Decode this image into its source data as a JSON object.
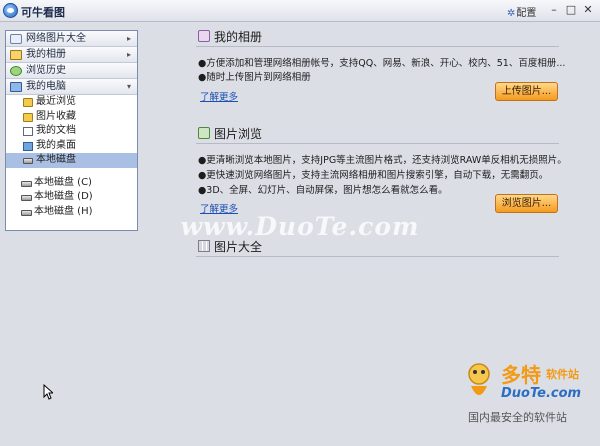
{
  "window": {
    "title": "可牛看图",
    "config_label": "配置",
    "min_glyph": "–",
    "max_glyph": "□",
    "close_glyph": "✕"
  },
  "sidebar": {
    "headers": [
      {
        "label": "网络图片大全",
        "icon": "globe-icon",
        "arrow": "▸"
      },
      {
        "label": "我的相册",
        "icon": "album-icon",
        "arrow": "▸"
      },
      {
        "label": "浏览历史",
        "icon": "history-icon",
        "arrow": ""
      },
      {
        "label": "我的电脑",
        "icon": "computer-icon",
        "arrow": "▾"
      }
    ],
    "items": [
      {
        "label": "最近浏览",
        "icon": "folder-icon"
      },
      {
        "label": "图片收藏",
        "icon": "folder-icon"
      },
      {
        "label": "我的文档",
        "icon": "document-icon"
      },
      {
        "label": "我的桌面",
        "icon": "desktop-icon"
      },
      {
        "label": "本地磁盘",
        "icon": "drive-icon",
        "selected": true
      }
    ],
    "drives": [
      {
        "label": "本地磁盘 (C)",
        "icon": "drive-icon"
      },
      {
        "label": "本地磁盘 (D)",
        "icon": "drive-icon"
      },
      {
        "label": "本地磁盘 (H)",
        "icon": "drive-icon"
      }
    ]
  },
  "sections": {
    "album": {
      "title": "我的相册",
      "icon": "album-icon",
      "lines": [
        "●方便添加和管理网络相册帐号，支持QQ、网易、新浪、开心、校内、51、百度相册...",
        "●随时上传图片到网络相册"
      ],
      "more": "了解更多",
      "button": "上传图片..."
    },
    "browse": {
      "title": "图片浏览",
      "icon": "image-icon",
      "lines": [
        "●更清晰浏览本地图片，支持JPG等主流图片格式，还支持浏览RAW单反相机无损照片。",
        "●更快速浏览网络图片，支持主流网络相册和图片搜索引擎，自动下载，无需翻页。",
        "●3D、全屏、幻灯片、自动屏保，图片想怎么看就怎么看。"
      ],
      "more": "了解更多",
      "button": "浏览图片..."
    },
    "gallery": {
      "title": "图片大全",
      "icon": "grid-icon"
    }
  },
  "watermark": "www.DuoTe.com",
  "logo": {
    "big": "多特",
    "small": "软件站",
    "url": "DuoTe.com",
    "slogan": "国内最安全的软件站"
  },
  "colors": {
    "accent_orange": "#f59a1f",
    "link_blue": "#1c4fb3",
    "selection": "#a9c0e4",
    "panel_bg": "#dcdee6"
  }
}
